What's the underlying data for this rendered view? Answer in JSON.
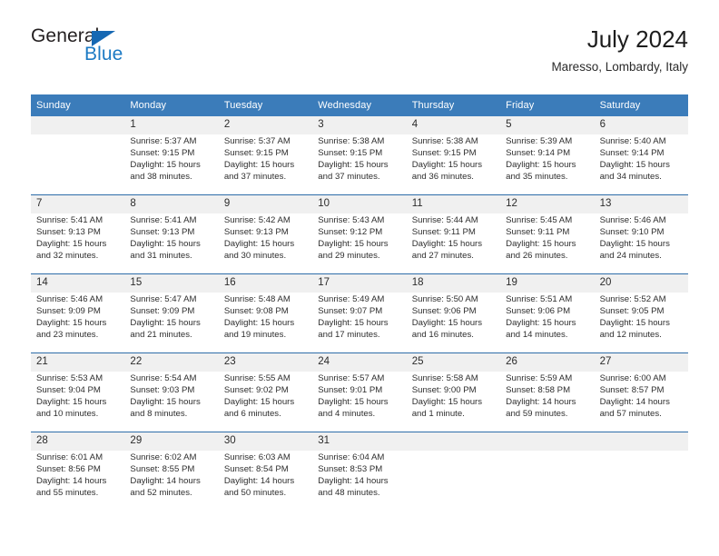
{
  "brand": {
    "word_one": "General",
    "word_two": "Blue",
    "logo_icon": "triangle-icon"
  },
  "header": {
    "title": "July 2024",
    "subtitle": "Maresso, Lombardy, Italy"
  },
  "colors": {
    "header_blue": "#3b7cba",
    "row_rule_blue": "#2e6da9",
    "daynum_band_gray": "#f0f0f0",
    "brand_blue": "#1c7ac4",
    "text": "#2e2e2e"
  },
  "weekdays": [
    "Sunday",
    "Monday",
    "Tuesday",
    "Wednesday",
    "Thursday",
    "Friday",
    "Saturday"
  ],
  "weeks": [
    [
      {
        "day": "",
        "lines": []
      },
      {
        "day": "1",
        "lines": [
          "Sunrise: 5:37 AM",
          "Sunset: 9:15 PM",
          "Daylight: 15 hours",
          "and 38 minutes."
        ]
      },
      {
        "day": "2",
        "lines": [
          "Sunrise: 5:37 AM",
          "Sunset: 9:15 PM",
          "Daylight: 15 hours",
          "and 37 minutes."
        ]
      },
      {
        "day": "3",
        "lines": [
          "Sunrise: 5:38 AM",
          "Sunset: 9:15 PM",
          "Daylight: 15 hours",
          "and 37 minutes."
        ]
      },
      {
        "day": "4",
        "lines": [
          "Sunrise: 5:38 AM",
          "Sunset: 9:15 PM",
          "Daylight: 15 hours",
          "and 36 minutes."
        ]
      },
      {
        "day": "5",
        "lines": [
          "Sunrise: 5:39 AM",
          "Sunset: 9:14 PM",
          "Daylight: 15 hours",
          "and 35 minutes."
        ]
      },
      {
        "day": "6",
        "lines": [
          "Sunrise: 5:40 AM",
          "Sunset: 9:14 PM",
          "Daylight: 15 hours",
          "and 34 minutes."
        ]
      }
    ],
    [
      {
        "day": "7",
        "lines": [
          "Sunrise: 5:41 AM",
          "Sunset: 9:13 PM",
          "Daylight: 15 hours",
          "and 32 minutes."
        ]
      },
      {
        "day": "8",
        "lines": [
          "Sunrise: 5:41 AM",
          "Sunset: 9:13 PM",
          "Daylight: 15 hours",
          "and 31 minutes."
        ]
      },
      {
        "day": "9",
        "lines": [
          "Sunrise: 5:42 AM",
          "Sunset: 9:13 PM",
          "Daylight: 15 hours",
          "and 30 minutes."
        ]
      },
      {
        "day": "10",
        "lines": [
          "Sunrise: 5:43 AM",
          "Sunset: 9:12 PM",
          "Daylight: 15 hours",
          "and 29 minutes."
        ]
      },
      {
        "day": "11",
        "lines": [
          "Sunrise: 5:44 AM",
          "Sunset: 9:11 PM",
          "Daylight: 15 hours",
          "and 27 minutes."
        ]
      },
      {
        "day": "12",
        "lines": [
          "Sunrise: 5:45 AM",
          "Sunset: 9:11 PM",
          "Daylight: 15 hours",
          "and 26 minutes."
        ]
      },
      {
        "day": "13",
        "lines": [
          "Sunrise: 5:46 AM",
          "Sunset: 9:10 PM",
          "Daylight: 15 hours",
          "and 24 minutes."
        ]
      }
    ],
    [
      {
        "day": "14",
        "lines": [
          "Sunrise: 5:46 AM",
          "Sunset: 9:09 PM",
          "Daylight: 15 hours",
          "and 23 minutes."
        ]
      },
      {
        "day": "15",
        "lines": [
          "Sunrise: 5:47 AM",
          "Sunset: 9:09 PM",
          "Daylight: 15 hours",
          "and 21 minutes."
        ]
      },
      {
        "day": "16",
        "lines": [
          "Sunrise: 5:48 AM",
          "Sunset: 9:08 PM",
          "Daylight: 15 hours",
          "and 19 minutes."
        ]
      },
      {
        "day": "17",
        "lines": [
          "Sunrise: 5:49 AM",
          "Sunset: 9:07 PM",
          "Daylight: 15 hours",
          "and 17 minutes."
        ]
      },
      {
        "day": "18",
        "lines": [
          "Sunrise: 5:50 AM",
          "Sunset: 9:06 PM",
          "Daylight: 15 hours",
          "and 16 minutes."
        ]
      },
      {
        "day": "19",
        "lines": [
          "Sunrise: 5:51 AM",
          "Sunset: 9:06 PM",
          "Daylight: 15 hours",
          "and 14 minutes."
        ]
      },
      {
        "day": "20",
        "lines": [
          "Sunrise: 5:52 AM",
          "Sunset: 9:05 PM",
          "Daylight: 15 hours",
          "and 12 minutes."
        ]
      }
    ],
    [
      {
        "day": "21",
        "lines": [
          "Sunrise: 5:53 AM",
          "Sunset: 9:04 PM",
          "Daylight: 15 hours",
          "and 10 minutes."
        ]
      },
      {
        "day": "22",
        "lines": [
          "Sunrise: 5:54 AM",
          "Sunset: 9:03 PM",
          "Daylight: 15 hours",
          "and 8 minutes."
        ]
      },
      {
        "day": "23",
        "lines": [
          "Sunrise: 5:55 AM",
          "Sunset: 9:02 PM",
          "Daylight: 15 hours",
          "and 6 minutes."
        ]
      },
      {
        "day": "24",
        "lines": [
          "Sunrise: 5:57 AM",
          "Sunset: 9:01 PM",
          "Daylight: 15 hours",
          "and 4 minutes."
        ]
      },
      {
        "day": "25",
        "lines": [
          "Sunrise: 5:58 AM",
          "Sunset: 9:00 PM",
          "Daylight: 15 hours",
          "and 1 minute."
        ]
      },
      {
        "day": "26",
        "lines": [
          "Sunrise: 5:59 AM",
          "Sunset: 8:58 PM",
          "Daylight: 14 hours",
          "and 59 minutes."
        ]
      },
      {
        "day": "27",
        "lines": [
          "Sunrise: 6:00 AM",
          "Sunset: 8:57 PM",
          "Daylight: 14 hours",
          "and 57 minutes."
        ]
      }
    ],
    [
      {
        "day": "28",
        "lines": [
          "Sunrise: 6:01 AM",
          "Sunset: 8:56 PM",
          "Daylight: 14 hours",
          "and 55 minutes."
        ]
      },
      {
        "day": "29",
        "lines": [
          "Sunrise: 6:02 AM",
          "Sunset: 8:55 PM",
          "Daylight: 14 hours",
          "and 52 minutes."
        ]
      },
      {
        "day": "30",
        "lines": [
          "Sunrise: 6:03 AM",
          "Sunset: 8:54 PM",
          "Daylight: 14 hours",
          "and 50 minutes."
        ]
      },
      {
        "day": "31",
        "lines": [
          "Sunrise: 6:04 AM",
          "Sunset: 8:53 PM",
          "Daylight: 14 hours",
          "and 48 minutes."
        ]
      },
      {
        "day": "",
        "lines": []
      },
      {
        "day": "",
        "lines": []
      },
      {
        "day": "",
        "lines": []
      }
    ]
  ]
}
